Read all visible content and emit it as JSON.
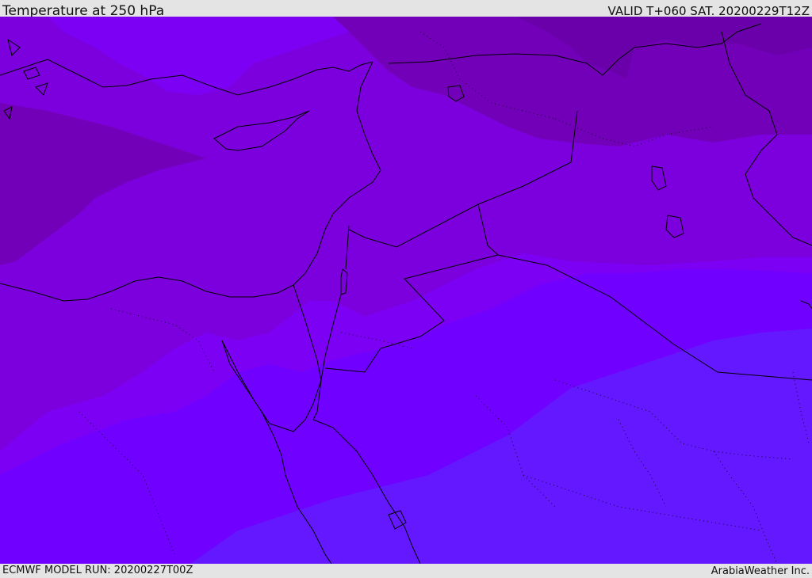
{
  "header": {
    "title": "Temperature at 250 hPa",
    "valid_time": "VALID T+060 SAT. 20200229T12Z"
  },
  "footer": {
    "model_run": "ECMWF MODEL RUN: 20200227T00Z",
    "provider": "ArabiaWeather Inc."
  },
  "map": {
    "field": "temperature",
    "pressure_level": "250 hPa",
    "palette": {
      "coldest": "#6a00aa",
      "cold": "#7200b8",
      "mid_cold": "#7a00cc",
      "mid": "#7c00de",
      "mid_warm": "#7c00f4",
      "warm": "#7000ff",
      "warmest": "#6418ff"
    },
    "coastline_color": "#000000",
    "border_style": "dotted"
  }
}
